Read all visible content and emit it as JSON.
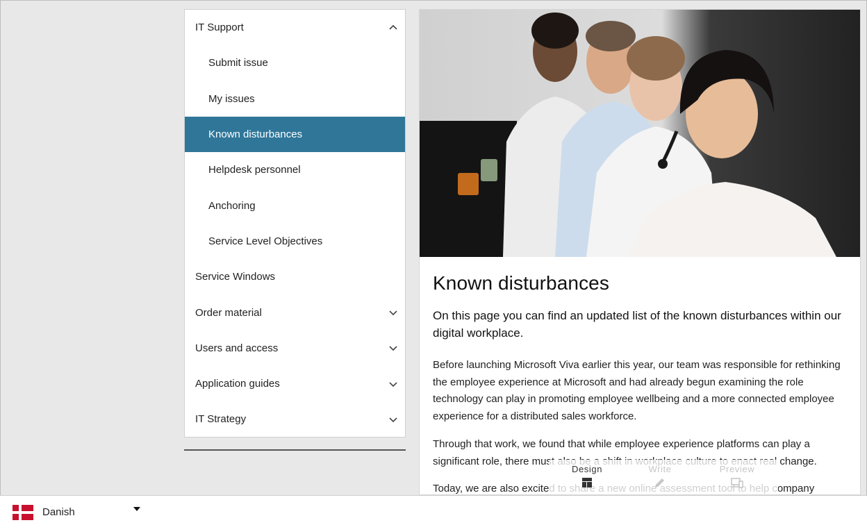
{
  "nav": {
    "items": [
      {
        "label": "IT Support",
        "level": 0,
        "chevron": "up",
        "active": false
      },
      {
        "label": "Submit issue",
        "level": 1,
        "chevron": "",
        "active": false
      },
      {
        "label": "My issues",
        "level": 1,
        "chevron": "",
        "active": false
      },
      {
        "label": "Known disturbances",
        "level": 1,
        "chevron": "",
        "active": true
      },
      {
        "label": "Helpdesk personnel",
        "level": 1,
        "chevron": "",
        "active": false
      },
      {
        "label": "Anchoring",
        "level": 1,
        "chevron": "",
        "active": false
      },
      {
        "label": "Service Level Objectives",
        "level": 1,
        "chevron": "",
        "active": false
      },
      {
        "label": "Service Windows",
        "level": 0,
        "chevron": "",
        "active": false
      },
      {
        "label": "Order material",
        "level": 0,
        "chevron": "down",
        "active": false
      },
      {
        "label": "Users and access",
        "level": 0,
        "chevron": "down",
        "active": false
      },
      {
        "label": "Application guides",
        "level": 0,
        "chevron": "down",
        "active": false
      },
      {
        "label": "IT Strategy",
        "level": 0,
        "chevron": "down",
        "active": false
      }
    ]
  },
  "article": {
    "title": "Known disturbances",
    "lead": "On this page you can find an updated list of the known disturbances within our digital workplace.",
    "paragraphs": [
      "Before launching Microsoft Viva earlier this year, our team was responsible for rethinking the employee experience at Microsoft and had already begun examining the role technology can play in promoting employee wellbeing and a more connected employee experience for a distributed sales workforce.",
      "Through that work, we found that while employee experience platforms can play a significant role, there must also be a shift in workplace culture to enact real change.",
      "Today, we are also excited to share a new online assessment tool to help company"
    ]
  },
  "toolbar": {
    "design_label": "Design",
    "write_label": "Write",
    "preview_label": "Preview"
  },
  "footer": {
    "language_label": "Danish",
    "flag_icon": "denmark-flag-icon"
  },
  "colors": {
    "accent": "#2f7699",
    "flag_red": "#c8102e"
  }
}
